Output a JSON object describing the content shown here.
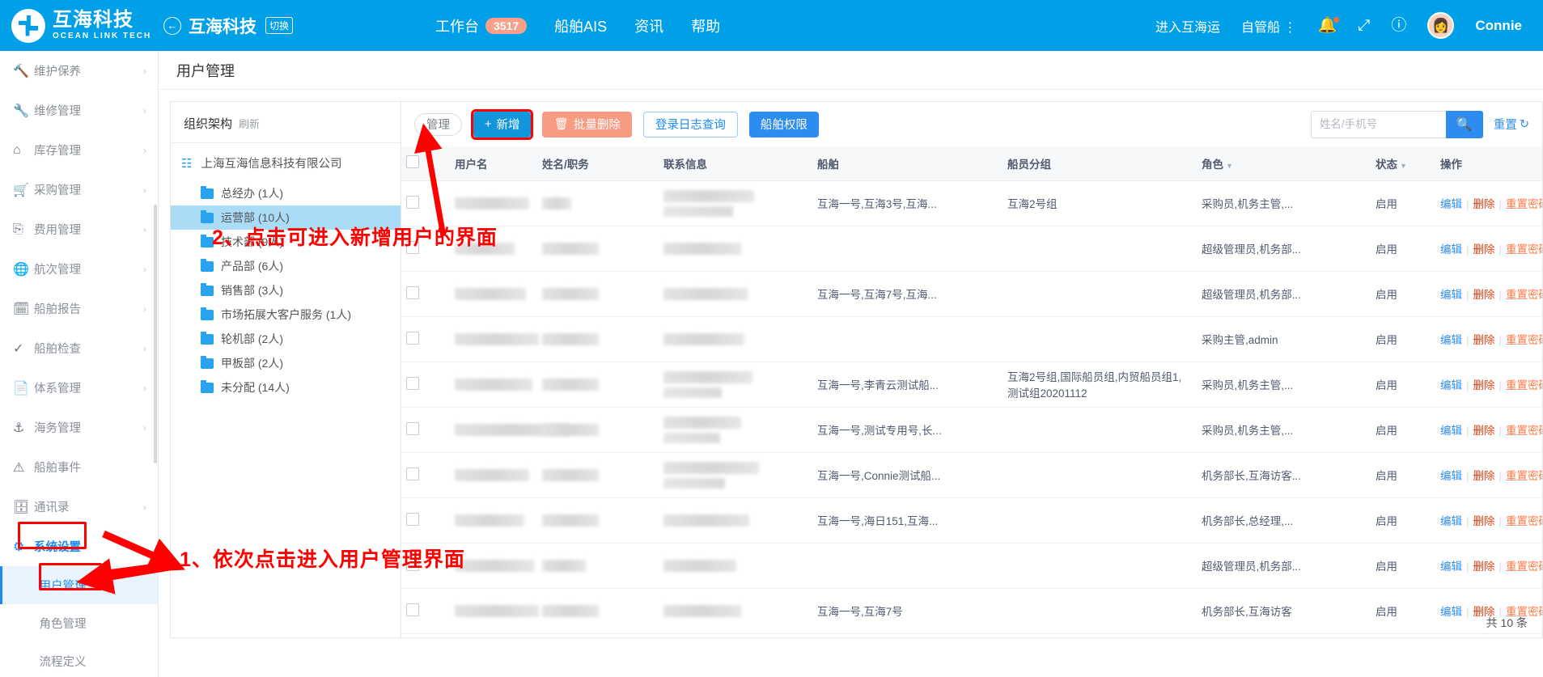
{
  "topbar": {
    "brand_cn": "互海科技",
    "brand_en": "OCEAN LINK TECH",
    "tenant": "互海科技",
    "switch_tag": "切换",
    "nav": [
      {
        "label": "工作台",
        "badge": "3517"
      },
      {
        "label": "船舶AIS",
        "badge": ""
      },
      {
        "label": "资讯",
        "badge": ""
      },
      {
        "label": "帮助",
        "badge": ""
      }
    ],
    "enter_link": "进入互海运",
    "fleet_select": "自管船",
    "username": "Connie",
    "icons": {
      "back": "back-arrow-icon",
      "bell": "bell-icon",
      "fullscreen": "fullscreen-icon",
      "help": "question-circle-icon",
      "avatar": "avatar"
    }
  },
  "sidebar": {
    "items": [
      {
        "label": "维护保养",
        "icon": "wrench-screwdriver-icon",
        "arrow": "›"
      },
      {
        "label": "维修管理",
        "icon": "wrench-icon",
        "arrow": "›"
      },
      {
        "label": "库存管理",
        "icon": "home-icon",
        "arrow": "›"
      },
      {
        "label": "采购管理",
        "icon": "cart-icon",
        "arrow": "›"
      },
      {
        "label": "费用管理",
        "icon": "database-icon",
        "arrow": "›"
      },
      {
        "label": "航次管理",
        "icon": "globe-icon",
        "arrow": "›"
      },
      {
        "label": "船舶报告",
        "icon": "calendar-icon",
        "arrow": "›"
      },
      {
        "label": "船舶检查",
        "icon": "check-circle-icon",
        "arrow": "›"
      },
      {
        "label": "体系管理",
        "icon": "documents-icon",
        "arrow": "›"
      },
      {
        "label": "海务管理",
        "icon": "anchor-icon",
        "arrow": "›"
      },
      {
        "label": "船舶事件",
        "icon": "warning-triangle-icon",
        "arrow": ""
      },
      {
        "label": "通讯录",
        "icon": "contacts-icon",
        "arrow": "›"
      },
      {
        "label": "系统设置",
        "icon": "gear-icon",
        "arrow": "⌄"
      }
    ],
    "subitems": [
      {
        "label": "用户管理",
        "active": true
      },
      {
        "label": "角色管理",
        "active": false
      },
      {
        "label": "流程定义",
        "active": false
      }
    ]
  },
  "page": {
    "title": "用户管理"
  },
  "org": {
    "header": "组织架构",
    "refresh": "刷新",
    "root": "上海互海信息科技有限公司",
    "nodes": [
      {
        "label": "总经办 (1人)",
        "selected": false
      },
      {
        "label": "运营部 (10人)",
        "selected": true
      },
      {
        "label": "技术部 (9人)",
        "selected": false
      },
      {
        "label": "产品部 (6人)",
        "selected": false
      },
      {
        "label": "销售部 (3人)",
        "selected": false
      },
      {
        "label": "市场拓展大客户服务 (1人)",
        "selected": false
      },
      {
        "label": "轮机部 (2人)",
        "selected": false
      },
      {
        "label": "甲板部 (2人)",
        "selected": false
      },
      {
        "label": "未分配 (14人)",
        "selected": false
      }
    ]
  },
  "toolbar": {
    "manage_label": "管理",
    "add_label": "新增",
    "add_icon": "plus-icon",
    "batch_delete_label": "批量删除",
    "batch_delete_icon": "trash-icon",
    "login_log_label": "登录日志查询",
    "ship_permission_label": "船舶权限",
    "search_placeholder": "姓名/手机号",
    "search_value": "",
    "search_icon": "search-icon",
    "reset_label": "重置",
    "reset_icon": "refresh-icon"
  },
  "table": {
    "columns": [
      "用户名",
      "姓名/职务",
      "联系信息",
      "船舶",
      "船员分组",
      "角色",
      "状态",
      "操作"
    ],
    "sortable": {
      "role": "角色",
      "status": "状态"
    },
    "ops": {
      "edit": "编辑",
      "delete": "删除",
      "reset_pwd": "重置密码"
    },
    "rows": [
      {
        "ship": "互海一号,互海3号,互海...",
        "group": "互海2号组",
        "role": "采购员,机务主管,...",
        "status": "启用"
      },
      {
        "ship": "",
        "group": "",
        "role": "超级管理员,机务部...",
        "status": "启用"
      },
      {
        "ship": "互海一号,互海7号,互海...",
        "group": "",
        "role": "超级管理员,机务部...",
        "status": "启用"
      },
      {
        "ship": "",
        "group": "",
        "role": "采购主管,admin",
        "status": "启用"
      },
      {
        "ship": "互海一号,李青云测试船...",
        "group": "互海2号组,国际船员组,内贸船员组1,测试组20201112",
        "role": "采购员,机务主管,...",
        "status": "启用"
      },
      {
        "ship": "互海一号,测试专用号,长...",
        "group": "",
        "role": "采购员,机务主管,...",
        "status": "启用"
      },
      {
        "ship": "互海一号,Connie测试船...",
        "group": "",
        "role": "机务部长,互海访客...",
        "status": "启用"
      },
      {
        "ship": "互海一号,海日151,互海...",
        "group": "",
        "role": "机务部长,总经理,...",
        "status": "启用"
      },
      {
        "ship": "",
        "group": "",
        "role": "超级管理员,机务部...",
        "status": "启用"
      },
      {
        "ship": "互海一号,互海7号",
        "group": "",
        "role": "机务部长,互海访客",
        "status": "启用"
      }
    ],
    "total_text": "共 10 条"
  },
  "annotations": [
    {
      "id": "step1",
      "text": "1、依次点击进入用户管理界面"
    },
    {
      "id": "step2",
      "text": "2、点击可进入新增用户的界面"
    }
  ]
}
